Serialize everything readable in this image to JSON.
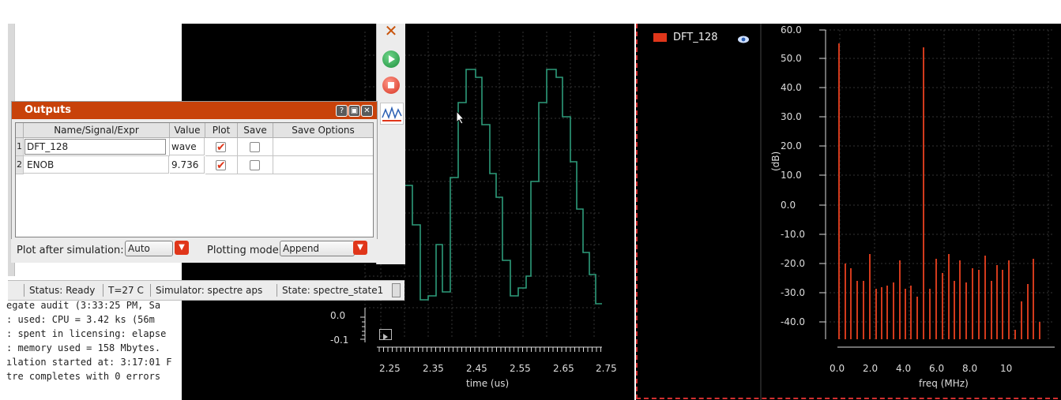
{
  "outputs": {
    "title": "Outputs",
    "columns": [
      "Name/Signal/Expr",
      "Value",
      "Plot",
      "Save",
      "Save Options"
    ],
    "rows": [
      {
        "num": "1",
        "name": "DFT_128",
        "value": "wave",
        "plot": true,
        "save": false
      },
      {
        "num": "2",
        "name": "ENOB",
        "value": "9.736",
        "plot": true,
        "save": false
      }
    ],
    "plot_after_label": "Plot after simulation:",
    "plot_after_value": "Auto",
    "plotting_mode_label": "Plotting mode:",
    "plotting_mode_value": "Append"
  },
  "status": {
    "status": "Status: Ready",
    "temp": "T=27 C",
    "simulator": "Simulator: spectre aps",
    "state": "State: spectre_state1"
  },
  "log_lines": [
    "egate audit (3:33:25 PM, Sa",
    ": used: CPU = 3.42 ks (56m",
    ": spent in licensing: elapse",
    ": memory used = 158 Mbytes.",
    "ılation started at: 3:17:01 F",
    "tre completes with 0 errors"
  ],
  "left_plot": {
    "y_ticks": [
      "0.0",
      "-0.1"
    ],
    "x_ticks": [
      "2.25",
      "2.35",
      "2.45",
      "2.55",
      "2.65",
      "2.75"
    ],
    "x_label": "time (us)",
    "line_color": "#2e9c7a"
  },
  "right_plot": {
    "legend": "DFT_128",
    "legend_color": "#e0361a",
    "y_label": "(dB)",
    "x_label": "freq (MHz)",
    "y_ticks": [
      "60.0",
      "50.0",
      "40.0",
      "30.0",
      "20.0",
      "10.0",
      "0.0",
      "-10.0",
      "-20.0",
      "-30.0",
      "-40.0"
    ],
    "x_ticks": [
      "0.0",
      "2.0",
      "4.0",
      "6.0",
      "8.0",
      "10"
    ]
  },
  "icons": [
    "close-x-icon",
    "run-icon",
    "stop-icon",
    "waveform-icon",
    "eye-icon",
    "play-small-icon"
  ],
  "colors": {
    "accent": "#c8420a",
    "plot_bg": "#000000"
  }
}
